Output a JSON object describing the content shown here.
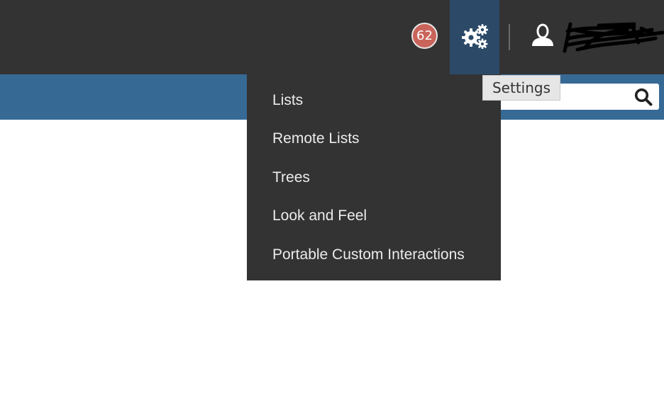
{
  "header": {
    "notification_count": "62",
    "settings_tooltip": "Settings"
  },
  "search": {
    "placeholder": "",
    "value": ""
  },
  "settings_menu": {
    "items": [
      {
        "label": "Lists"
      },
      {
        "label": "Remote Lists"
      },
      {
        "label": "Trees"
      },
      {
        "label": "Look and Feel"
      },
      {
        "label": "Portable Custom Interactions"
      }
    ]
  },
  "colors": {
    "topbar": "#333333",
    "subbar": "#376995",
    "settings_active": "#2c4a68",
    "badge": "#c9645a"
  },
  "icons": {
    "settings": "gears-icon",
    "user": "user-icon",
    "search": "search-icon"
  }
}
